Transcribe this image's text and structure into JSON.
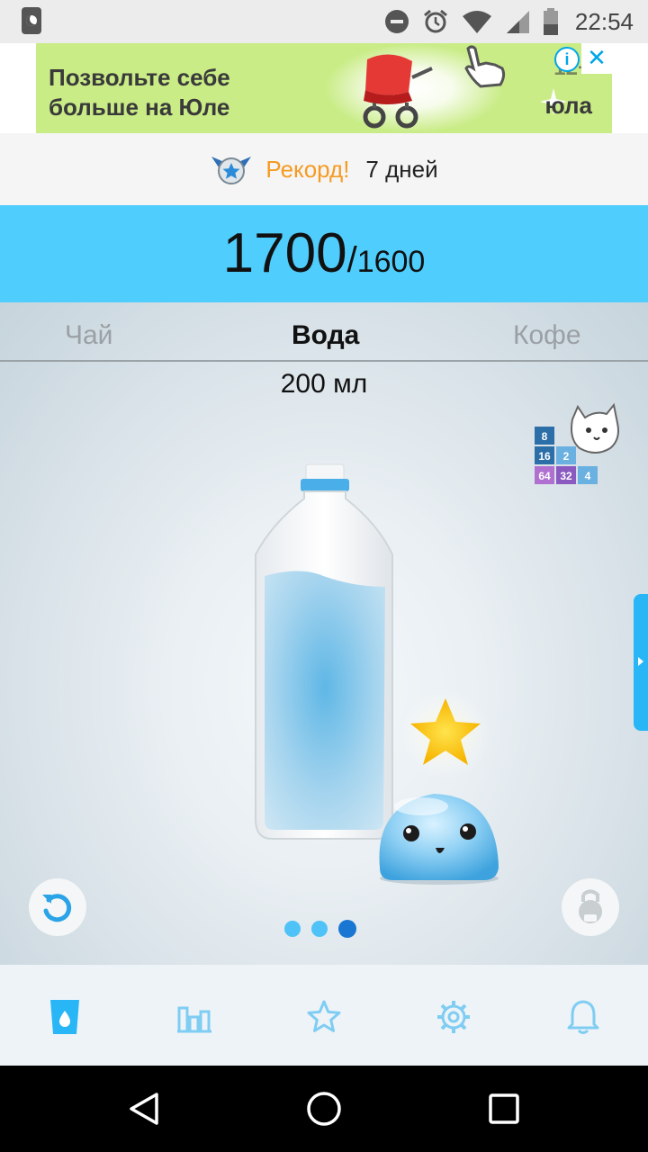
{
  "status_bar": {
    "time": "22:54",
    "icons": [
      "moon-icon",
      "do-not-disturb-icon",
      "alarm-icon",
      "wifi-icon",
      "signal-icon",
      "battery-icon"
    ]
  },
  "ad": {
    "line1": "Позвольте себе",
    "line2": "больше на Юле",
    "brand": "юла",
    "age_rating": "12+",
    "info_label": "i",
    "close_label": "✕",
    "background": "#c9ec86"
  },
  "record": {
    "label": "Рекорд!",
    "days": "7 дней"
  },
  "counter": {
    "value": "1700",
    "separator": "/",
    "goal": "1600",
    "background": "#4fcdfd"
  },
  "tabs": {
    "tea": "Чай",
    "water": "Вода",
    "coffee": "Кофе",
    "selected": "Вода"
  },
  "drink": {
    "volume": "200 мл"
  },
  "game_ad": {
    "tiles": [
      "8",
      "16",
      "2",
      "64",
      "32",
      "4"
    ]
  },
  "pager": {
    "total": 3,
    "active_index": 2
  },
  "bottom_nav": {
    "items": [
      "cup-icon",
      "stats-icon",
      "star-icon",
      "settings-icon",
      "bell-icon"
    ],
    "active": "cup-icon",
    "accent": "#29b6f6"
  },
  "system_nav": {
    "buttons": [
      "back-icon",
      "home-icon",
      "recents-icon"
    ]
  }
}
